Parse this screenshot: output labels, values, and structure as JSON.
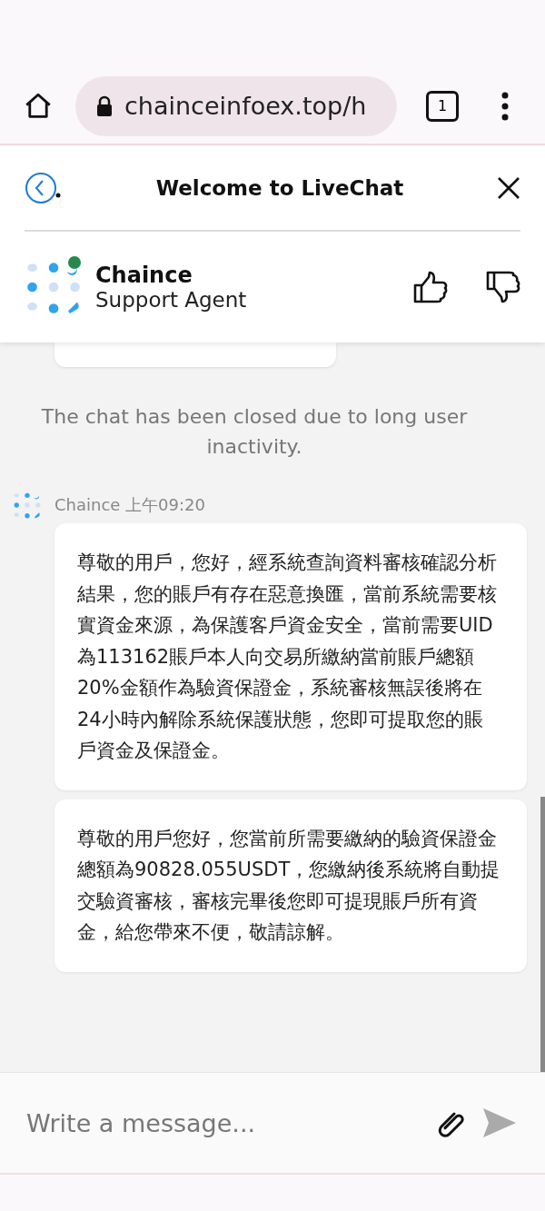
{
  "browser": {
    "url": "chainceinfoex.top/h",
    "tab_count": "1"
  },
  "chat_header": {
    "title": "Welcome to LiveChat",
    "agent_name": "Chaince",
    "agent_role": "Support Agent"
  },
  "system_notice": "The chat has been closed due to long user inactivity.",
  "message_group": {
    "sender": "Chaince",
    "time": "上午09:20"
  },
  "messages": [
    {
      "text": "尊敬的用戶，您好，經系統查詢資料審核確認分析結果，您的賬戶有存在惡意換匯，當前系統需要核實資金來源，為保護客戶資金安全，當前需要UID為113162賬戶本人向交易所繳納當前賬戶總額20%金額作為驗資保證金，系統審核無誤後將在24小時內解除系統保護狀態，您即可提取您的賬戶資金及保證金。"
    },
    {
      "text": "尊敬的用戶您好，您當前所需要繳納的驗資保證金總額為90828.055USDT，您繳納後系統將自動提交驗資審核，審核完畢後您即可提現賬戶所有資金，給您帶來不便，敬請諒解。"
    }
  ],
  "composer": {
    "placeholder": "Write a message..."
  }
}
